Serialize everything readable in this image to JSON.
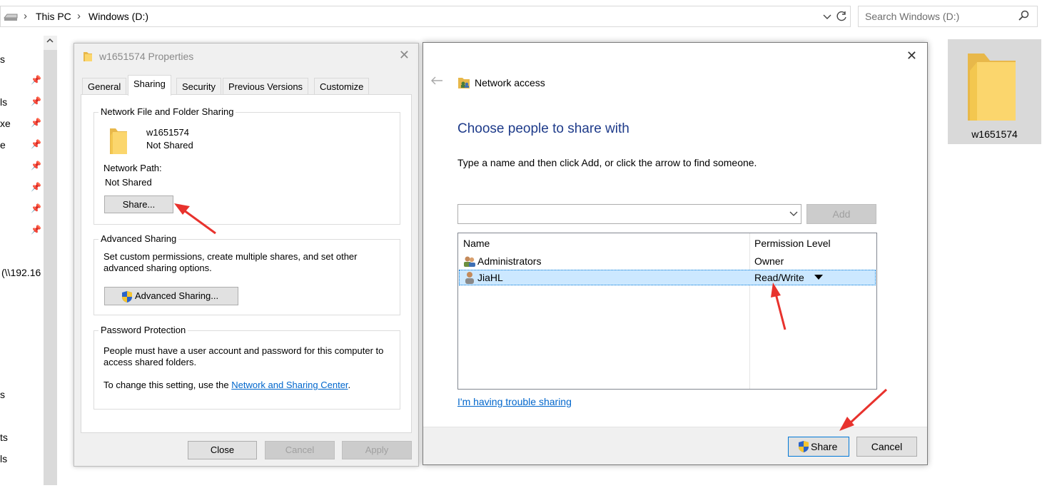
{
  "explorer": {
    "breadcrumb": [
      "This PC",
      "Windows (D:)"
    ],
    "search_placeholder": "Search Windows (D:)",
    "nav_fragments": [
      "s",
      "ls",
      "xe",
      "e",
      "(\\\\192.16",
      "s",
      "ts",
      "ls"
    ],
    "folder_tile_label": "w1651574"
  },
  "properties": {
    "title": "w1651574 Properties",
    "tabs": [
      "General",
      "Sharing",
      "Security",
      "Previous Versions",
      "Customize"
    ],
    "active_tab": "Sharing",
    "network_sharing": {
      "group_label": "Network File and Folder Sharing",
      "folder_name": "w1651574",
      "status": "Not Shared",
      "path_label": "Network Path:",
      "path_value": "Not Shared",
      "share_button": "Share..."
    },
    "advanced_sharing": {
      "group_label": "Advanced Sharing",
      "description": "Set custom permissions, create multiple shares, and set other advanced sharing options.",
      "button": "Advanced Sharing..."
    },
    "password_protection": {
      "group_label": "Password Protection",
      "description": "People must have a user account and password for this computer to access shared folders.",
      "change_prefix": "To change this setting, use the ",
      "link": "Network and Sharing Center",
      "change_suffix": "."
    },
    "buttons": {
      "close": "Close",
      "cancel": "Cancel",
      "apply": "Apply"
    }
  },
  "network_access": {
    "title": "Network access",
    "heading": "Choose people to share with",
    "instruction": "Type a name and then click Add, or click the arrow to find someone.",
    "combo_value": "",
    "add_button": "Add",
    "columns": {
      "name": "Name",
      "permission": "Permission Level"
    },
    "rows": [
      {
        "name": "Administrators",
        "permission": "Owner",
        "selected": false
      },
      {
        "name": "JiaHL",
        "permission": "Read/Write",
        "selected": true
      }
    ],
    "trouble_link": "I'm having trouble sharing",
    "share_button": "Share",
    "cancel_button": "Cancel"
  },
  "colors": {
    "heading_blue": "#1e3b8a",
    "link_blue": "#0066cc",
    "selection": "#cce8ff",
    "annotation_red": "#e8322d"
  }
}
